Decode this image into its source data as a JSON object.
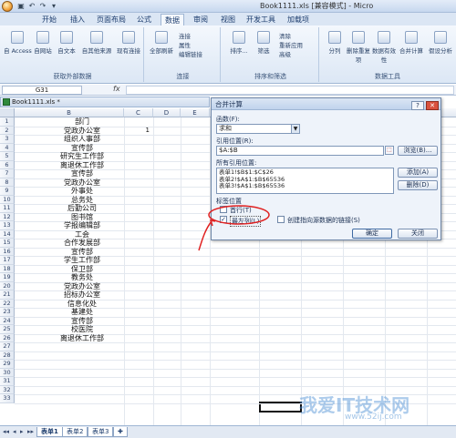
{
  "window": {
    "title": "Book1111.xls [兼容模式] - Micro"
  },
  "ribbon_tabs": [
    "开始",
    "插入",
    "页面布局",
    "公式",
    "数据",
    "审阅",
    "视图",
    "开发工具",
    "加载项"
  ],
  "ribbon": {
    "get_external": {
      "label": "获取外部数据",
      "buttons": [
        "自 Access",
        "自网站",
        "自文本",
        "自其他来源",
        "现有连接"
      ]
    },
    "connections": {
      "label": "连接",
      "buttons": [
        "全部刷新",
        "连接",
        "属性",
        "编辑链接"
      ]
    },
    "sort_filter": {
      "label": "排序和筛选",
      "buttons": [
        "排序...",
        "筛选",
        "清除",
        "重新应用",
        "高级"
      ]
    },
    "data_tools": {
      "label": "数据工具",
      "buttons": [
        "分列",
        "删除重复项",
        "数据有效性",
        "合并计算",
        "假设分析"
      ]
    }
  },
  "formula_bar": {
    "name_box": "G31",
    "fx": "fx"
  },
  "workbook": {
    "name": "Book1111.xls *"
  },
  "columns": [
    "B",
    "C",
    "D",
    "E"
  ],
  "rows": [
    {
      "num": "1",
      "b": "部门",
      "c": ""
    },
    {
      "num": "2",
      "b": "党政办公室",
      "c": "1"
    },
    {
      "num": "3",
      "b": "组织人事部",
      "c": ""
    },
    {
      "num": "4",
      "b": "宣传部",
      "c": ""
    },
    {
      "num": "5",
      "b": "研究生工作部",
      "c": ""
    },
    {
      "num": "6",
      "b": "离退休工作部",
      "c": ""
    },
    {
      "num": "7",
      "b": "宣传部",
      "c": ""
    },
    {
      "num": "8",
      "b": "党政办公室",
      "c": ""
    },
    {
      "num": "9",
      "b": "外事处",
      "c": ""
    },
    {
      "num": "10",
      "b": "总务处",
      "c": ""
    },
    {
      "num": "11",
      "b": "后勤公司",
      "c": ""
    },
    {
      "num": "12",
      "b": "图书馆",
      "c": ""
    },
    {
      "num": "13",
      "b": "学报编辑部",
      "c": ""
    },
    {
      "num": "14",
      "b": "工会",
      "c": ""
    },
    {
      "num": "15",
      "b": "合作发展部",
      "c": ""
    },
    {
      "num": "16",
      "b": "宣传部",
      "c": ""
    },
    {
      "num": "17",
      "b": "学生工作部",
      "c": ""
    },
    {
      "num": "18",
      "b": "保卫部",
      "c": ""
    },
    {
      "num": "19",
      "b": "教务处",
      "c": ""
    },
    {
      "num": "20",
      "b": "党政办公室",
      "c": ""
    },
    {
      "num": "21",
      "b": "招标办公室",
      "c": ""
    },
    {
      "num": "22",
      "b": "信息化处",
      "c": ""
    },
    {
      "num": "23",
      "b": "基建处",
      "c": ""
    },
    {
      "num": "24",
      "b": "宣传部",
      "c": ""
    },
    {
      "num": "25",
      "b": "校医院",
      "c": ""
    },
    {
      "num": "26",
      "b": "离退休工作部",
      "c": ""
    },
    {
      "num": "27",
      "b": "",
      "c": ""
    },
    {
      "num": "28",
      "b": "",
      "c": ""
    },
    {
      "num": "29",
      "b": "",
      "c": ""
    },
    {
      "num": "30",
      "b": "",
      "c": ""
    },
    {
      "num": "31",
      "b": "",
      "c": ""
    },
    {
      "num": "32",
      "b": "",
      "c": ""
    },
    {
      "num": "33",
      "b": "",
      "c": ""
    }
  ],
  "sheets": [
    "表单1",
    "表单2",
    "表单3"
  ],
  "dialog": {
    "title": "合并计算",
    "function_label": "函数(F):",
    "function_value": "求和",
    "ref_label": "引用位置(R):",
    "ref_value": "$A:$B",
    "browse": "浏览(B)...",
    "all_refs_label": "所有引用位置:",
    "all_refs": [
      "表单1!$B$1:$C$26",
      "表单2!$A$1:$B$65536",
      "表单3!$A$1:$B$65536"
    ],
    "add": "添加(A)",
    "delete": "删除(D)",
    "labels_title": "标签位置",
    "top_row": "首行(T)",
    "left_col": "最左列(L)",
    "create_links": "创建指向源数据的链接(S)",
    "ok": "确定",
    "close": "关闭"
  },
  "watermark": {
    "text": "我爱IT技术网",
    "url": "www.52ij.com"
  },
  "colors": {
    "annotation": "#e02020",
    "ribbon": "#dce7f5",
    "accent": "#3f6aa3"
  }
}
